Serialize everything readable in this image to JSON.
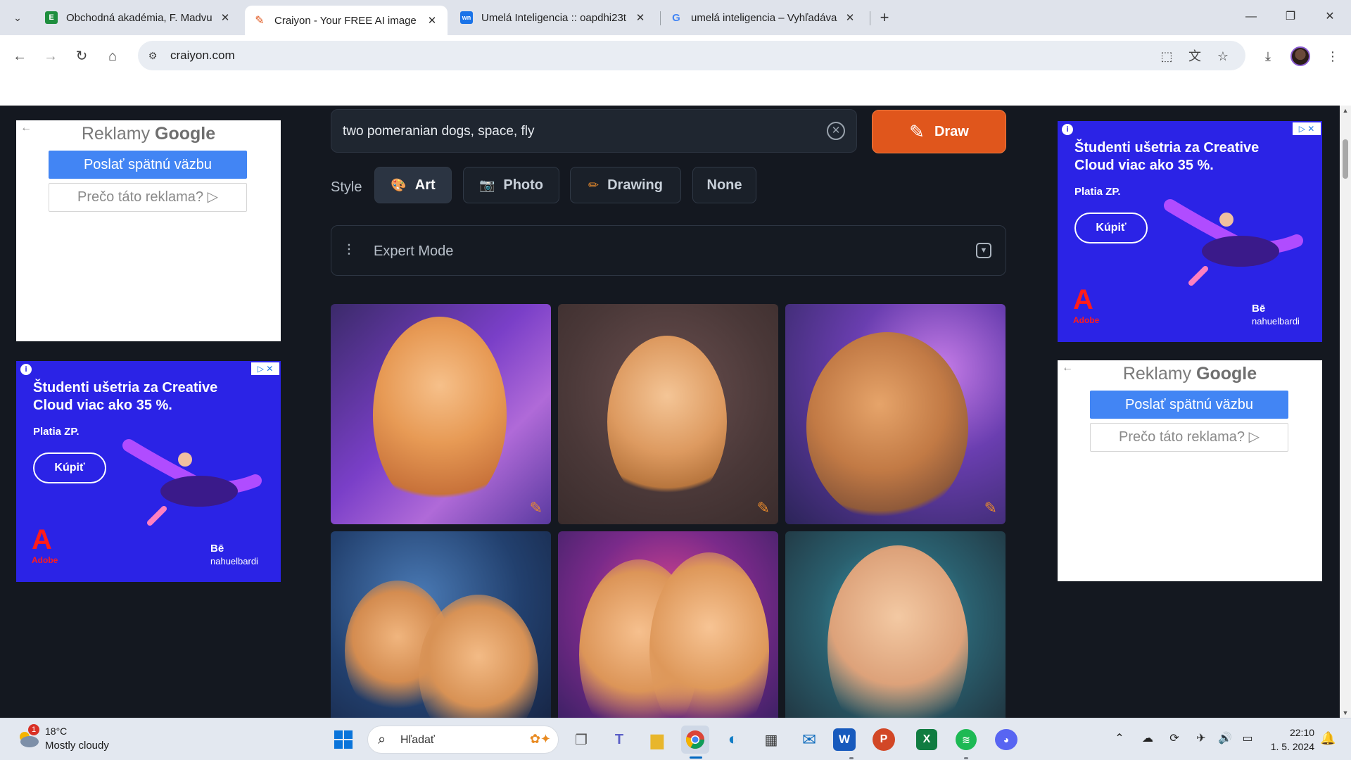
{
  "tabs": [
    {
      "title": "Obchodná akadémia, F. Madvu",
      "favicon": "E",
      "favicon_color": "#1e8e3e"
    },
    {
      "title": "Craiyon - Your FREE AI image g",
      "favicon": "✎",
      "favicon_color": "#e0561c"
    },
    {
      "title": "Umelá Inteligencia :: oapdhi23t",
      "favicon": "wn",
      "favicon_color": "#1a73e8"
    },
    {
      "title": "umelá inteligencia – Vyhľadáva",
      "favicon": "G",
      "favicon_color": "#4285f4"
    }
  ],
  "tab_close": "✕",
  "newtab": "+",
  "window": {
    "minimize": "—",
    "restore": "❐",
    "close": "✕"
  },
  "address": {
    "url": "craiyon.com"
  },
  "page": {
    "prompt": "two pomeranian dogs, space, fly",
    "draw_label": "Draw",
    "style_label": "Style",
    "styles": [
      {
        "label": "Art",
        "icon": "palette-icon",
        "glyph": "🎨"
      },
      {
        "label": "Photo",
        "icon": "camera-icon",
        "glyph": "📷"
      },
      {
        "label": "Drawing",
        "icon": "pencil-icon",
        "glyph": "✏"
      },
      {
        "label": "None",
        "icon": "",
        "glyph": ""
      }
    ],
    "selected_style": "Art",
    "expert_mode": "Expert Mode"
  },
  "ads": {
    "google_brand_prefix": "Reklamy",
    "google_brand": "Google",
    "feedback": "Poslať spätnú väzbu",
    "why": "Prečo táto reklama? ▷",
    "adobe_headline": "Študenti ušetria za Creative Cloud viac ako 35 %.",
    "adobe_sub": "Platia ZP.",
    "adobe_cta": "Kúpiť",
    "adobe_brand": "Adobe",
    "artist_name": "Bē",
    "artist_handle": "nahuelbardi",
    "accent_blue": "#2b23e6",
    "feedback_blue": "#4285f4"
  },
  "taskbar": {
    "temperature": "18°C",
    "weather": "Mostly cloudy",
    "weather_badge": "1",
    "search_placeholder": "Hľadať",
    "time": "22:10",
    "date": "1. 5. 2024"
  },
  "colors": {
    "draw_button": "#e0561c",
    "page_bg": "#141820"
  }
}
